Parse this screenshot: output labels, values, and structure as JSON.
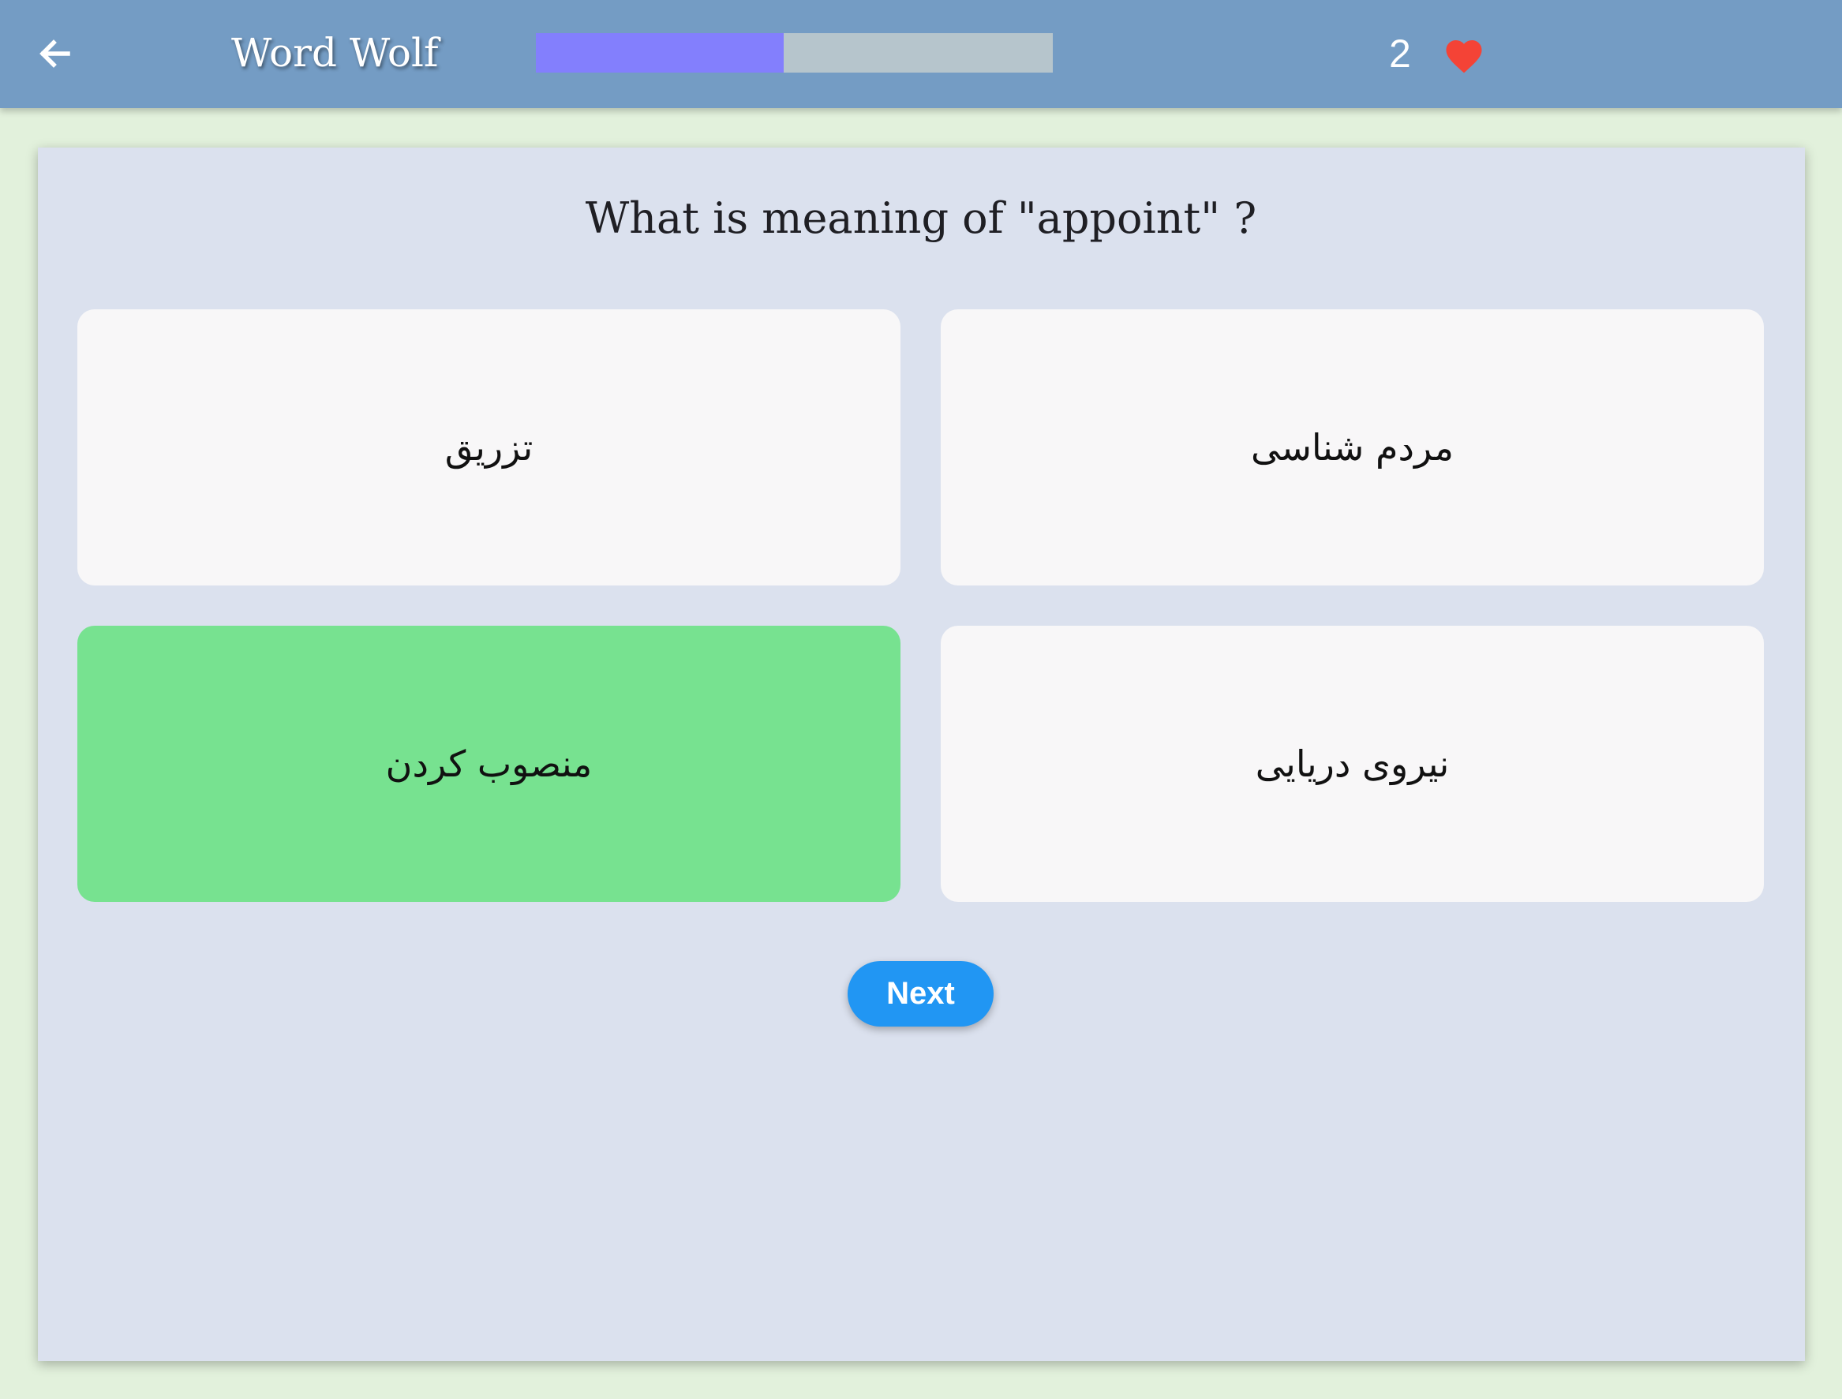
{
  "app_bar": {
    "title": "Word Wolf",
    "back_icon": "arrow-left-icon",
    "progress": {
      "fraction": 0.48,
      "fill_color": "#837ffd",
      "track_color": "#b6c5cc"
    },
    "lives": {
      "count": "2",
      "icon": "heart-icon",
      "color": "#f44336"
    }
  },
  "quiz": {
    "question": "What is meaning of \"appoint\" ?",
    "options": [
      {
        "label": "تزریق",
        "state": "default"
      },
      {
        "label": "مردم شناسی",
        "state": "default"
      },
      {
        "label": "منصوب کردن",
        "state": "correct"
      },
      {
        "label": "نیروی دریایی",
        "state": "default"
      }
    ],
    "next_label": "Next"
  },
  "colors": {
    "app_bar": "#749cc4",
    "page_background": "#e2f1dc",
    "card_background": "#dbe1ee",
    "option_background": "#f8f7f8",
    "correct_option": "#77e290",
    "next_button": "#2196f3"
  }
}
